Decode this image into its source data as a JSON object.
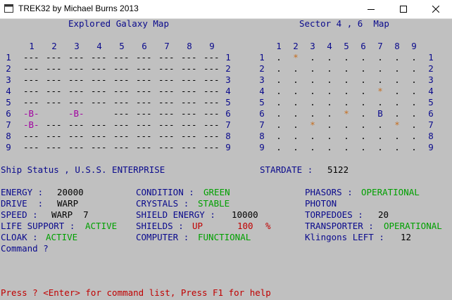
{
  "window": {
    "title": "TREK32 by Michael Burns 2013"
  },
  "galaxy_map": {
    "title": "Explored Galaxy Map",
    "columns": [
      "1",
      "2",
      "3",
      "4",
      "5",
      "6",
      "7",
      "8",
      "9"
    ],
    "rows": [
      {
        "label": "1",
        "cells": [
          "---",
          "---",
          "---",
          "---",
          "---",
          "---",
          "---",
          "---",
          "---"
        ]
      },
      {
        "label": "2",
        "cells": [
          "---",
          "---",
          "---",
          "---",
          "---",
          "---",
          "---",
          "---",
          "---"
        ]
      },
      {
        "label": "3",
        "cells": [
          "---",
          "---",
          "---",
          "---",
          "---",
          "---",
          "---",
          "---",
          "---"
        ]
      },
      {
        "label": "4",
        "cells": [
          "---",
          "---",
          "---",
          "---",
          "---",
          "---",
          "---",
          "---",
          "---"
        ]
      },
      {
        "label": "5",
        "cells": [
          "---",
          "---",
          "---",
          "---",
          "---",
          "---",
          "---",
          "---",
          "---"
        ]
      },
      {
        "label": "6",
        "cells": [
          "-B-",
          "",
          "-B-",
          "",
          "---",
          "---",
          "---",
          "---",
          "---"
        ]
      },
      {
        "label": "7",
        "cells": [
          "-B-",
          "---",
          "---",
          "---",
          "---",
          "---",
          "---",
          "---",
          "---"
        ]
      },
      {
        "label": "8",
        "cells": [
          "---",
          "---",
          "---",
          "---",
          "---",
          "---",
          "---",
          "---",
          "---"
        ]
      },
      {
        "label": "9",
        "cells": [
          "---",
          "---",
          "---",
          "---",
          "---",
          "---",
          "---",
          "---",
          "---"
        ]
      }
    ]
  },
  "sector_map": {
    "title": "Sector 4 , 6  Map",
    "columns": [
      "1",
      "2",
      "3",
      "4",
      "5",
      "6",
      "7",
      "8",
      "9"
    ],
    "rows": [
      {
        "label": "1",
        "cells": [
          ".",
          "*",
          ".",
          ".",
          ".",
          ".",
          ".",
          ".",
          "."
        ]
      },
      {
        "label": "2",
        "cells": [
          ".",
          ".",
          ".",
          ".",
          ".",
          ".",
          ".",
          ".",
          "."
        ]
      },
      {
        "label": "3",
        "cells": [
          ".",
          ".",
          ".",
          ".",
          ".",
          ".",
          ".",
          ".",
          "."
        ]
      },
      {
        "label": "4",
        "cells": [
          ".",
          ".",
          ".",
          ".",
          ".",
          ".",
          "*",
          ".",
          "."
        ]
      },
      {
        "label": "5",
        "cells": [
          ".",
          ".",
          ".",
          ".",
          ".",
          ".",
          ".",
          ".",
          "."
        ]
      },
      {
        "label": "6",
        "cells": [
          ".",
          ".",
          ".",
          ".",
          "*",
          ".",
          "B",
          ".",
          "."
        ]
      },
      {
        "label": "7",
        "cells": [
          ".",
          ".",
          "*",
          ".",
          ".",
          ".",
          ".",
          "*",
          "."
        ]
      },
      {
        "label": "8",
        "cells": [
          ".",
          ".",
          ".",
          ".",
          ".",
          ".",
          ".",
          ".",
          "."
        ]
      },
      {
        "label": "9",
        "cells": [
          ".",
          ".",
          ".",
          ".",
          ".",
          ".",
          ".",
          ".",
          "."
        ]
      }
    ]
  },
  "ship_status": {
    "title": "Ship Status , U.S.S. ENTERPRISE",
    "stardate_label": "STARDATE :",
    "stardate_value": "5122"
  },
  "status": {
    "energy_label": "ENERGY :",
    "energy_value": "20000",
    "drive_label": "DRIVE  :",
    "drive_value": "WARP",
    "speed_label": "SPEED :",
    "speed_value": "WARP  7",
    "life_label": "LIFE SUPPORT :",
    "life_value": "ACTIVE",
    "cloak_label": "CLOAK :",
    "cloak_value": "ACTIVE",
    "condition_label": "CONDITION :",
    "condition_value": "GREEN",
    "crystals_label": "CRYSTALS :",
    "crystals_value": "STABLE",
    "shield_energy_label": "SHIELD ENERGY :",
    "shield_energy_value": "10000",
    "shields_label": "SHIELDS :",
    "shields_state": "UP",
    "shields_pct": "100",
    "shields_pct_sign": "%",
    "computer_label": "COMPUTER :",
    "computer_value": "FUNCTIONAL",
    "phasors_label": "PHASORS :",
    "phasors_value": "OPERATIONAL",
    "photon_label": "PHOTON",
    "torpedoes_label": "TORPEDOES :",
    "torpedoes_value": "20",
    "transporter_label": "TRANSPORTER :",
    "transporter_value": "OPERATIONAL",
    "klingons_label": "Klingons LEFT :",
    "klingons_value": "12"
  },
  "prompt": {
    "command": "Command ?"
  },
  "footer": {
    "help": "Press ? <Enter> for command list, Press F1 for help"
  },
  "colors": {
    "accent": "#0a0a8c",
    "ok": "#00a000",
    "alert": "#c00000",
    "star": "#c66d1e",
    "starbase": "#a000a0"
  }
}
